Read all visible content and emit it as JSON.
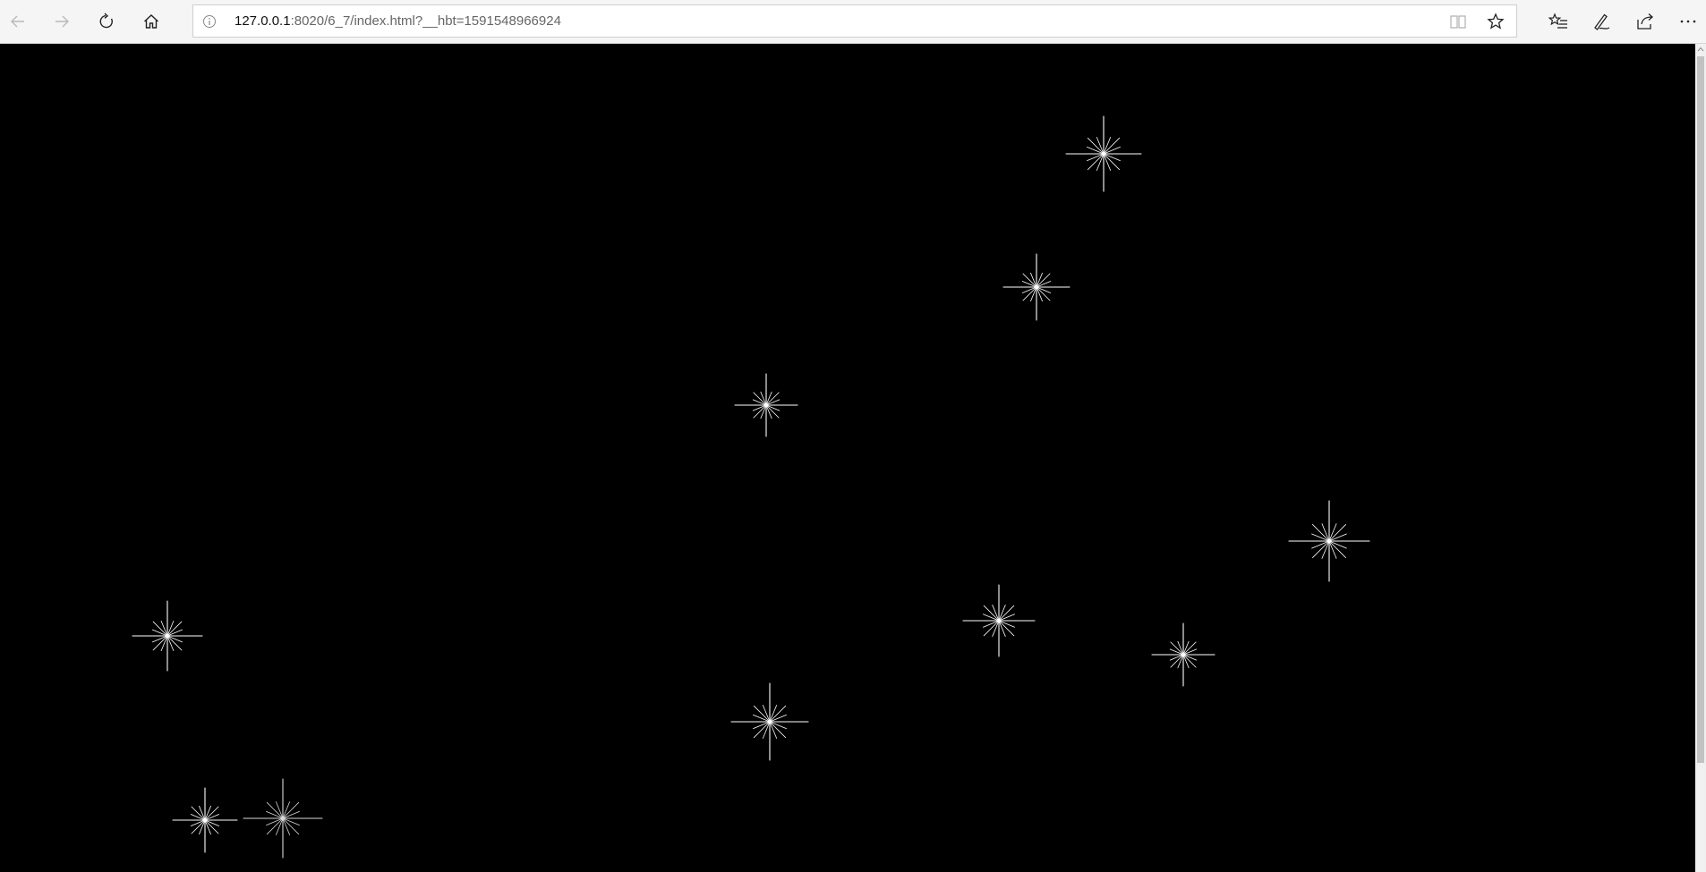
{
  "browser": {
    "url_host": "127.0.0.1",
    "url_rest": ":8020/6_7/index.html?__hbt=1591548966924",
    "nav_icons": [
      "back-arrow-icon",
      "forward-arrow-icon",
      "refresh-icon",
      "home-icon"
    ],
    "address_icons": [
      "info-icon",
      "reading-view-icon",
      "favorite-star-icon"
    ],
    "toolbar_icons": [
      "favorites-list-icon",
      "pen-icon",
      "share-icon",
      "more-icon"
    ]
  },
  "page": {
    "background": "#000000",
    "sparkle_color": "#ffffff",
    "sparkle_count": 11
  }
}
